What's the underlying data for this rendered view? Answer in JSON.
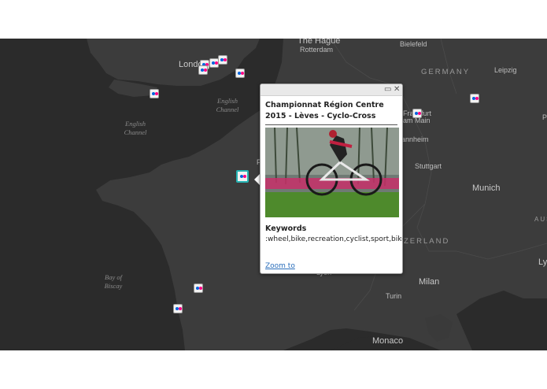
{
  "map": {
    "places": [
      {
        "id": "the-hague",
        "text": "The Hague"
      },
      {
        "id": "rotterdam",
        "text": "Rotterdam"
      },
      {
        "id": "bielefeld",
        "text": "Bielefeld"
      },
      {
        "id": "london",
        "text": "London"
      },
      {
        "id": "leipzig",
        "text": "Leipzig"
      },
      {
        "id": "frankfurt",
        "text": "Frankfurt"
      },
      {
        "id": "am-main",
        "text": "am Main"
      },
      {
        "id": "mannheim",
        "text": "annheim"
      },
      {
        "id": "stuttgart",
        "text": "Stuttgart"
      },
      {
        "id": "munich",
        "text": "Munich"
      },
      {
        "id": "milan",
        "text": "Milan"
      },
      {
        "id": "turin",
        "text": "Turin"
      },
      {
        "id": "monaco",
        "text": "Monaco"
      },
      {
        "id": "lyon",
        "text": "Lyon"
      },
      {
        "id": "paris-partial",
        "text": "P"
      },
      {
        "id": "p-right",
        "text": "P"
      },
      {
        "id": "ly-right",
        "text": "Ly"
      }
    ],
    "countries": [
      {
        "id": "germany",
        "text": "GERMANY"
      },
      {
        "id": "switzerland",
        "text": "ZERLAND"
      },
      {
        "id": "aus",
        "text": "AUS"
      }
    ],
    "seas": [
      {
        "id": "english-channel-1",
        "line1": "English",
        "line2": "Channel"
      },
      {
        "id": "english-channel-2",
        "line1": "English",
        "line2": "Channel"
      },
      {
        "id": "bay-of-biscay",
        "line1": "Bay of",
        "line2": "Biscay"
      }
    ],
    "colors": {
      "water": "#2b2b2b",
      "land": "#3c3c3c",
      "marker_highlight": "#25b3b3"
    },
    "marker_icon": "flickr-icon"
  },
  "popup": {
    "title": "Championnat Région Centre 2015 - Lèves - Cyclo-Cross",
    "photo_alt": "cyclist riding a cyclo-cross bike",
    "keywords_label": "Keywords",
    "keywords_value": ":wheel,bike,recreation,cyclist,sport,biker,cycle",
    "zoom_link": "Zoom to",
    "maximize_icon": "maximize-icon",
    "close_icon": "close-icon"
  }
}
